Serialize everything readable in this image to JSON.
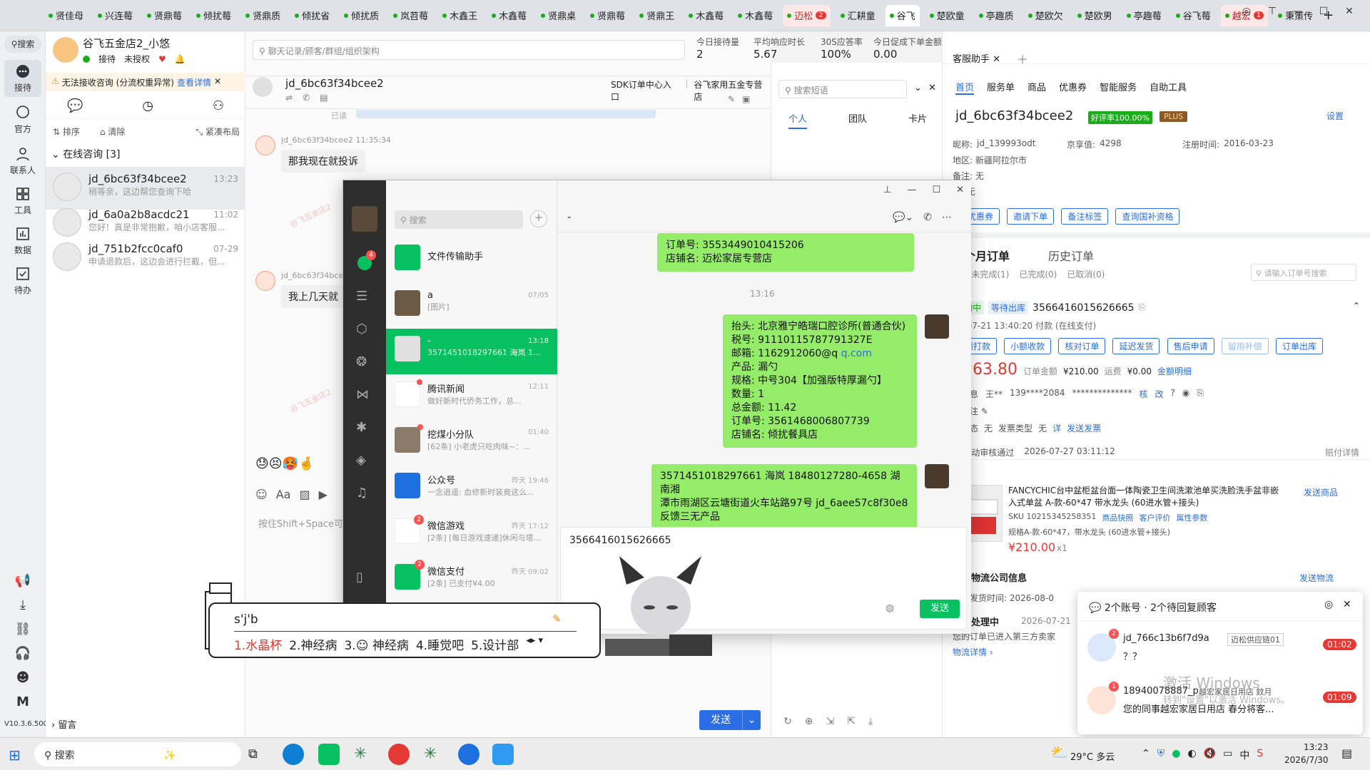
{
  "tabs": [
    "贤佳母",
    "兴连莓",
    "贤鼎莓",
    "倾扰莓",
    "贤鼎质",
    "倾扰省",
    "倾扰质",
    "岚苕莓",
    "木鑫王",
    "木鑫莓",
    "贤鼎桌",
    "贤鼎莓",
    "贤鼎王",
    "木鑫莓",
    "木鑫莓",
    "迈松",
    "汇耕童",
    "谷飞",
    "楚欧童",
    "亭趣质",
    "楚欧欠",
    "楚欧男",
    "亭趣莓",
    "谷飞莓",
    "越宏",
    "秉策传"
  ],
  "tab_badges": {
    "迈松": "2",
    "越宏": "1"
  },
  "rail": {
    "search": "搜索",
    "items": [
      "接待",
      "官方",
      "联系人",
      "工具",
      "数据",
      "待办"
    ],
    "version": "V10.3.6.500",
    "bottom_icons": [
      "megaphone-icon",
      "download-icon",
      "link-icon",
      "headset-icon",
      "chat-bot-icon",
      "m-icon"
    ]
  },
  "shop": {
    "name": "谷飞五金店2_小悠",
    "status": "接待",
    "auth": "未授权",
    "warning": "无法接收咨询 (分流权重异常)",
    "warning_link": "查看详情"
  },
  "list": {
    "sort": "排序",
    "clear": "清除",
    "layout": "紧凑布局",
    "section": "在线咨询 [3]",
    "message_label": "留言",
    "items": [
      {
        "name": "jd_6bc63f34bcee2",
        "time": "13:23",
        "preview": "稍等亲，这边帮您查询下哈"
      },
      {
        "name": "jd_6a0a2b8acdc21",
        "time": "11:02",
        "preview": "您好！真是非常抱歉，咱小店客服..."
      },
      {
        "name": "jd_751b2fcc0caf0",
        "time": "07-29",
        "preview": "申请退款后，这边会进行拦截，但..."
      }
    ]
  },
  "chat": {
    "search_placeholder": "聊天记录/顾客/群组/组织架构",
    "stats": [
      {
        "label": "今日接待量",
        "value": "2"
      },
      {
        "label": "平均响应时长",
        "value": "5.67"
      },
      {
        "label": "30S应答率",
        "value": "100%"
      },
      {
        "label": "今日促成下单金额",
        "value": "0.00"
      }
    ],
    "user": "jd_6bc63f34bcee2",
    "sdk": "SDK订单中心入口",
    "shop_tag": "谷飞家用五金专营店",
    "read": "已读",
    "msg1_meta": "jd_6bc63f34bcee2  11:35:34",
    "msg1": "那我现在就投诉",
    "msg2_meta": "jd_6bc63f34bcee",
    "msg2": "我上几天就",
    "input_hint": "按住Shift+Space可",
    "send": "发送",
    "watermark": "谷飞五金店2"
  },
  "quick": {
    "placeholder": "搜索短语",
    "tabs": [
      "个人",
      "团队",
      "卡片"
    ]
  },
  "right": {
    "assistant_tab": "客服助手",
    "tabs": [
      "首页",
      "服务单",
      "商品",
      "优惠券",
      "智能服务",
      "自助工具"
    ],
    "user": "jd_6bc63f34bcee2",
    "rate": "好评率100.00%",
    "plus": "PLUS",
    "settings": "设置",
    "nick_label": "昵称:",
    "nick": "jd_139993odt",
    "score_label": "京享值:",
    "score": "4298",
    "reg_label": "注册时间:",
    "reg": "2016-03-23",
    "region_label": "地区:",
    "region": "新疆阿拉尔市",
    "note_label": "备注:",
    "note": "无",
    "tag_label": "签:",
    "tag": "无",
    "actions": [
      "送优惠券",
      "邀请下单",
      "备注标签",
      "查询国补资格"
    ],
    "orders_tab": "三个月订单",
    "history_tab": "历史订单",
    "order_filters": [
      "1)",
      "未完成(1)",
      "已完成(0)",
      "已取消(0)"
    ],
    "order_search": "请输入订单号搜索",
    "order": {
      "status1": "咨询中",
      "status2": "等待出库",
      "id": "3566416015626665",
      "paytime": "26-07-21 13:40:20 付款",
      "paytype": "(在线支付)",
      "buttons": [
        "小额打款",
        "小额收款",
        "核对订单",
        "延迟发货",
        "售后申请",
        "留用补偿",
        "订单出库"
      ],
      "price": "¥163.80",
      "total_label": "订单金额",
      "total": "¥210.00",
      "ship_label": "运费",
      "ship": "¥0.00",
      "detail": "金额明细",
      "recv_label": "货信息",
      "recv_name": "王**",
      "recv_phone": "139****2084",
      "recv_addr": "**************",
      "remark_label": "家备注",
      "invoice_label": "票状态",
      "invoice": "无",
      "invoice_type_label": "发票类型",
      "invoice_type": "无",
      "invoice_detail": "详",
      "send_invoice": "发送发票",
      "audit": "自动审核通过",
      "audit_time": "2026-07-27 03:11:12",
      "pay_detail": "赔付详情"
    },
    "product": {
      "title": "FANCYCHIC台中盆柜盆台面一体陶瓷卫生间洗漱池单买洗脸洗手盆非嵌入式单盆 A-款-60*47 带水龙头 (60进水管+接头)",
      "sku": "SKU 10215345258351",
      "links": [
        "商品快照",
        "客户评价",
        "属性参数"
      ],
      "spec": "规格A-款-60*47，带水龙头 (60进水管+接头)",
      "price": "¥210.00",
      "qty": "x1",
      "send": "发送商品"
    },
    "logistics": "首无物流公司信息",
    "send_logistics": "发送物流",
    "ship_time": "最晚发货时间:  2026-08-0",
    "warehouse": "仓库处理中",
    "warehouse_time": "2026-07-21",
    "warehouse_text": "您的订单已进入第三方卖家",
    "logistics_link": "物流详情"
  },
  "wechat": {
    "search": "搜索",
    "chat_title": "-",
    "nav_badge": "4",
    "items": [
      {
        "title": "文件传输助手",
        "sub": "",
        "time": ""
      },
      {
        "title": "a",
        "sub": "[图片]",
        "time": "07/05"
      },
      {
        "title": "-",
        "sub": "3571451018297661 海岚 18...",
        "time": "13:18"
      },
      {
        "title": "腾讯新闻",
        "sub": "做好新时代侨务工作，总...",
        "time": "12:11"
      },
      {
        "title": "挖煤小分队",
        "sub": "[62条] 小老虎只吃肉味~：...",
        "time": "01:40"
      },
      {
        "title": "公众号",
        "sub": "一念逍遥: 血修新时装竟这么...",
        "time": "昨天 19:46"
      },
      {
        "title": "微信游戏",
        "sub": "[2条] [每日游戏速递]休闲与塔...",
        "time": "昨天 17:12"
      },
      {
        "title": "微信支付",
        "sub": "[2条] 已支付¥4.00",
        "time": "昨天 09:02"
      }
    ],
    "badges": {
      "微信游戏": "2",
      "微信支付": "2"
    },
    "msg_top": [
      "订单号: 3553449010415206",
      "店铺名:    迈松家居专营店"
    ],
    "timestamp": "13:16",
    "msg_invoice": [
      "抬头: 北京雅宁皓瑞口腔诊所(普通合伙)",
      "税号: 91110115787791327E",
      "邮箱: 1162912060@q",
      "产品: 漏勺",
      "规格: 中号304【加强版特厚漏勺】",
      "数量: 1",
      "总金额: 11.42",
      "订单号: 3561468006807739",
      "店铺名: 倾扰餐具店"
    ],
    "email_link": "q.com",
    "msg_addr": [
      "3571451018297661   海岚 18480127280-4658 湖南湘",
      "潭市雨湖区云塘街道火车站路97号   jd_6aee57c8f30e8",
      "反馈三无产品"
    ],
    "input": "3566416015626665",
    "send": "发送"
  },
  "ime": {
    "input": "s'j'b",
    "candidates": [
      "1.水晶杯",
      "2.神经病",
      "3.",
      "神经病",
      "4.睡觉吧",
      "5.设计部"
    ]
  },
  "popup": {
    "title": "2个账号 · 2个待回复顾客",
    "items": [
      {
        "name": "jd_766c13b6f7d9a",
        "shop": "迈松供应链01",
        "msg": "？？",
        "time": "01:02",
        "badge": "2"
      },
      {
        "name": "18940078887_p",
        "shop": "越宏家居日用店 鈫月",
        "msg": "您的同事越宏家居日用店 春分将客...",
        "time": "01:09",
        "badge": "1"
      }
    ]
  },
  "activation": {
    "line1": "激活 Windows",
    "line2": "转到\"设置\"以激活 Windows。"
  },
  "taskbar": {
    "search": "搜索",
    "weather": "29°C  多云",
    "time": "13:23",
    "date": "2026/7/30",
    "lang": "中",
    "weather_badge": "1"
  }
}
